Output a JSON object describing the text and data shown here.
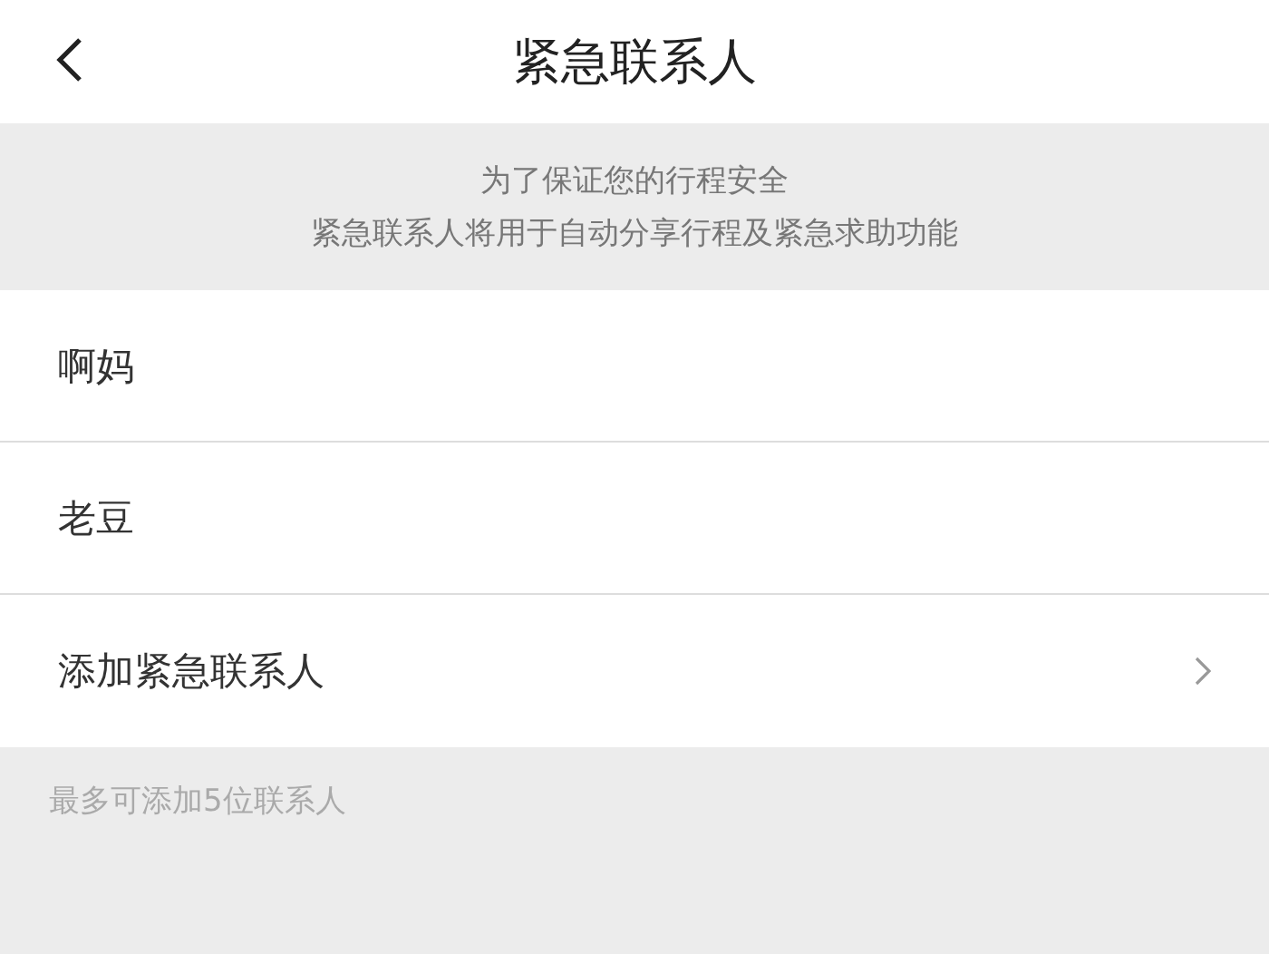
{
  "header": {
    "title": "紧急联系人"
  },
  "notice": {
    "lines": [
      "为了保证您的行程安全",
      "紧急联系人将用于自动分享行程及紧急求助功能"
    ]
  },
  "rows": [
    {
      "kind": "contact",
      "label": "啊妈"
    },
    {
      "kind": "contact",
      "label": "老豆"
    },
    {
      "kind": "add",
      "label": "添加紧急联系人"
    }
  ],
  "footer_note": "最多可添加5位联系人"
}
